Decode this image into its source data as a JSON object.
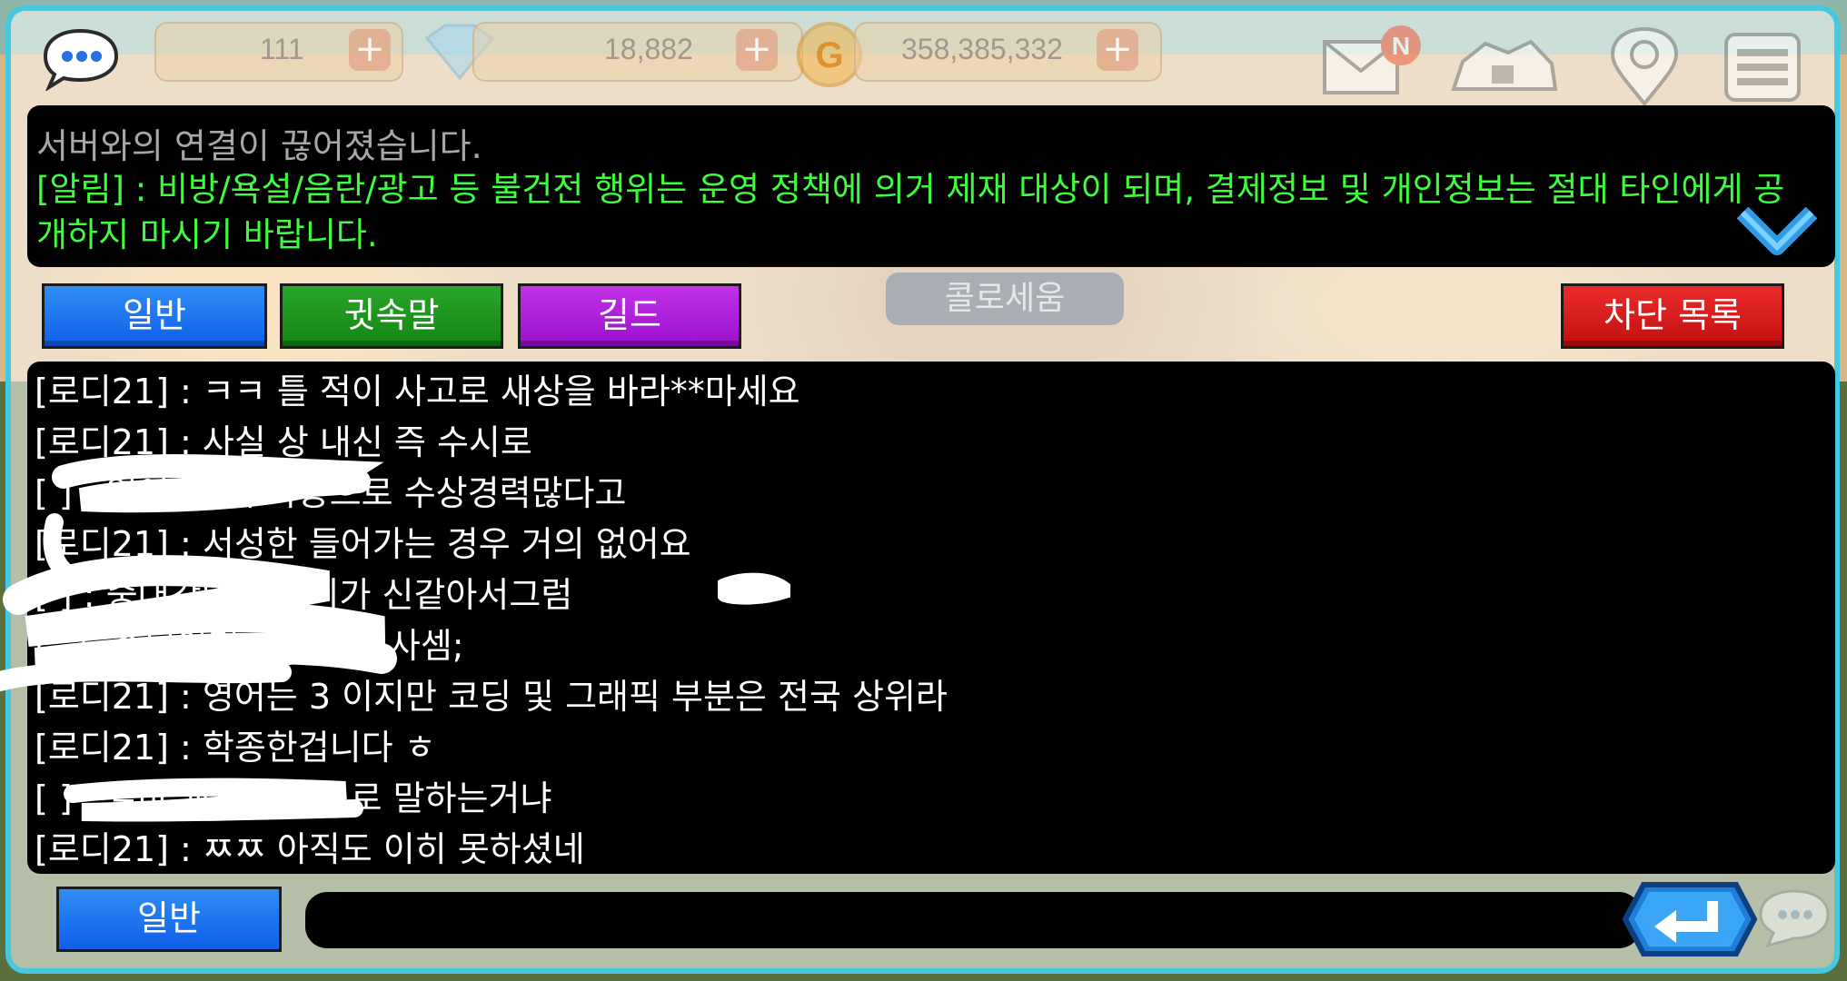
{
  "topbar": {
    "resource1": "111",
    "resource2": "18,882",
    "resource3": "358,385,332",
    "mail_badge": "N"
  },
  "notice": {
    "line1": "서버와의 연결이 끊어졌습니다.",
    "line2": "[알림] : 비방/욕설/음란/광고 등 불건전 행위는 운영 정책에 의거 제재 대상이 되며, 결제정보 및 개인정보는 절대 타인에게 공개하지 마시기 바랍니다."
  },
  "tabs": {
    "general": "일반",
    "whisper": "귓속말",
    "guild": "길드",
    "block_list": "차단 목록"
  },
  "background_label": "콜로세움",
  "messages": [
    "[로디21] : ㅋㅋ 틀 적이 사고로 새상을 바라**마세요",
    "[로디21] : 사실 상 내신 즉 수시로",
    "[                    ] : 영어5인데 학종으로 수상경력많다고",
    "[로디21] : 서성한 들어가는 경우 거의 없어요",
    "[                    ] : 중대간다는 논리가       신같아서그럼",
    "[                         그..중딩이면 중딩으로 사셈;",
    "[로디21] : 영어는 3 이지만 코딩 및 그래픽 부분은 전국 상위라",
    "[로디21] : 학종한겁니다 ㅎ",
    "[                    ] : 설마 교과를 수시로 말하는거냐",
    "[로디21] : ㅉㅉ 아직도 이히 못하셨네"
  ],
  "input": {
    "channel": "일반",
    "value": ""
  },
  "colors": {
    "notice_green": "#3dfd3d",
    "tab_blue": "#1a6ff0",
    "tab_green": "#1c961c",
    "tab_purple": "#b01fdc",
    "tab_red": "#d81c1c"
  }
}
